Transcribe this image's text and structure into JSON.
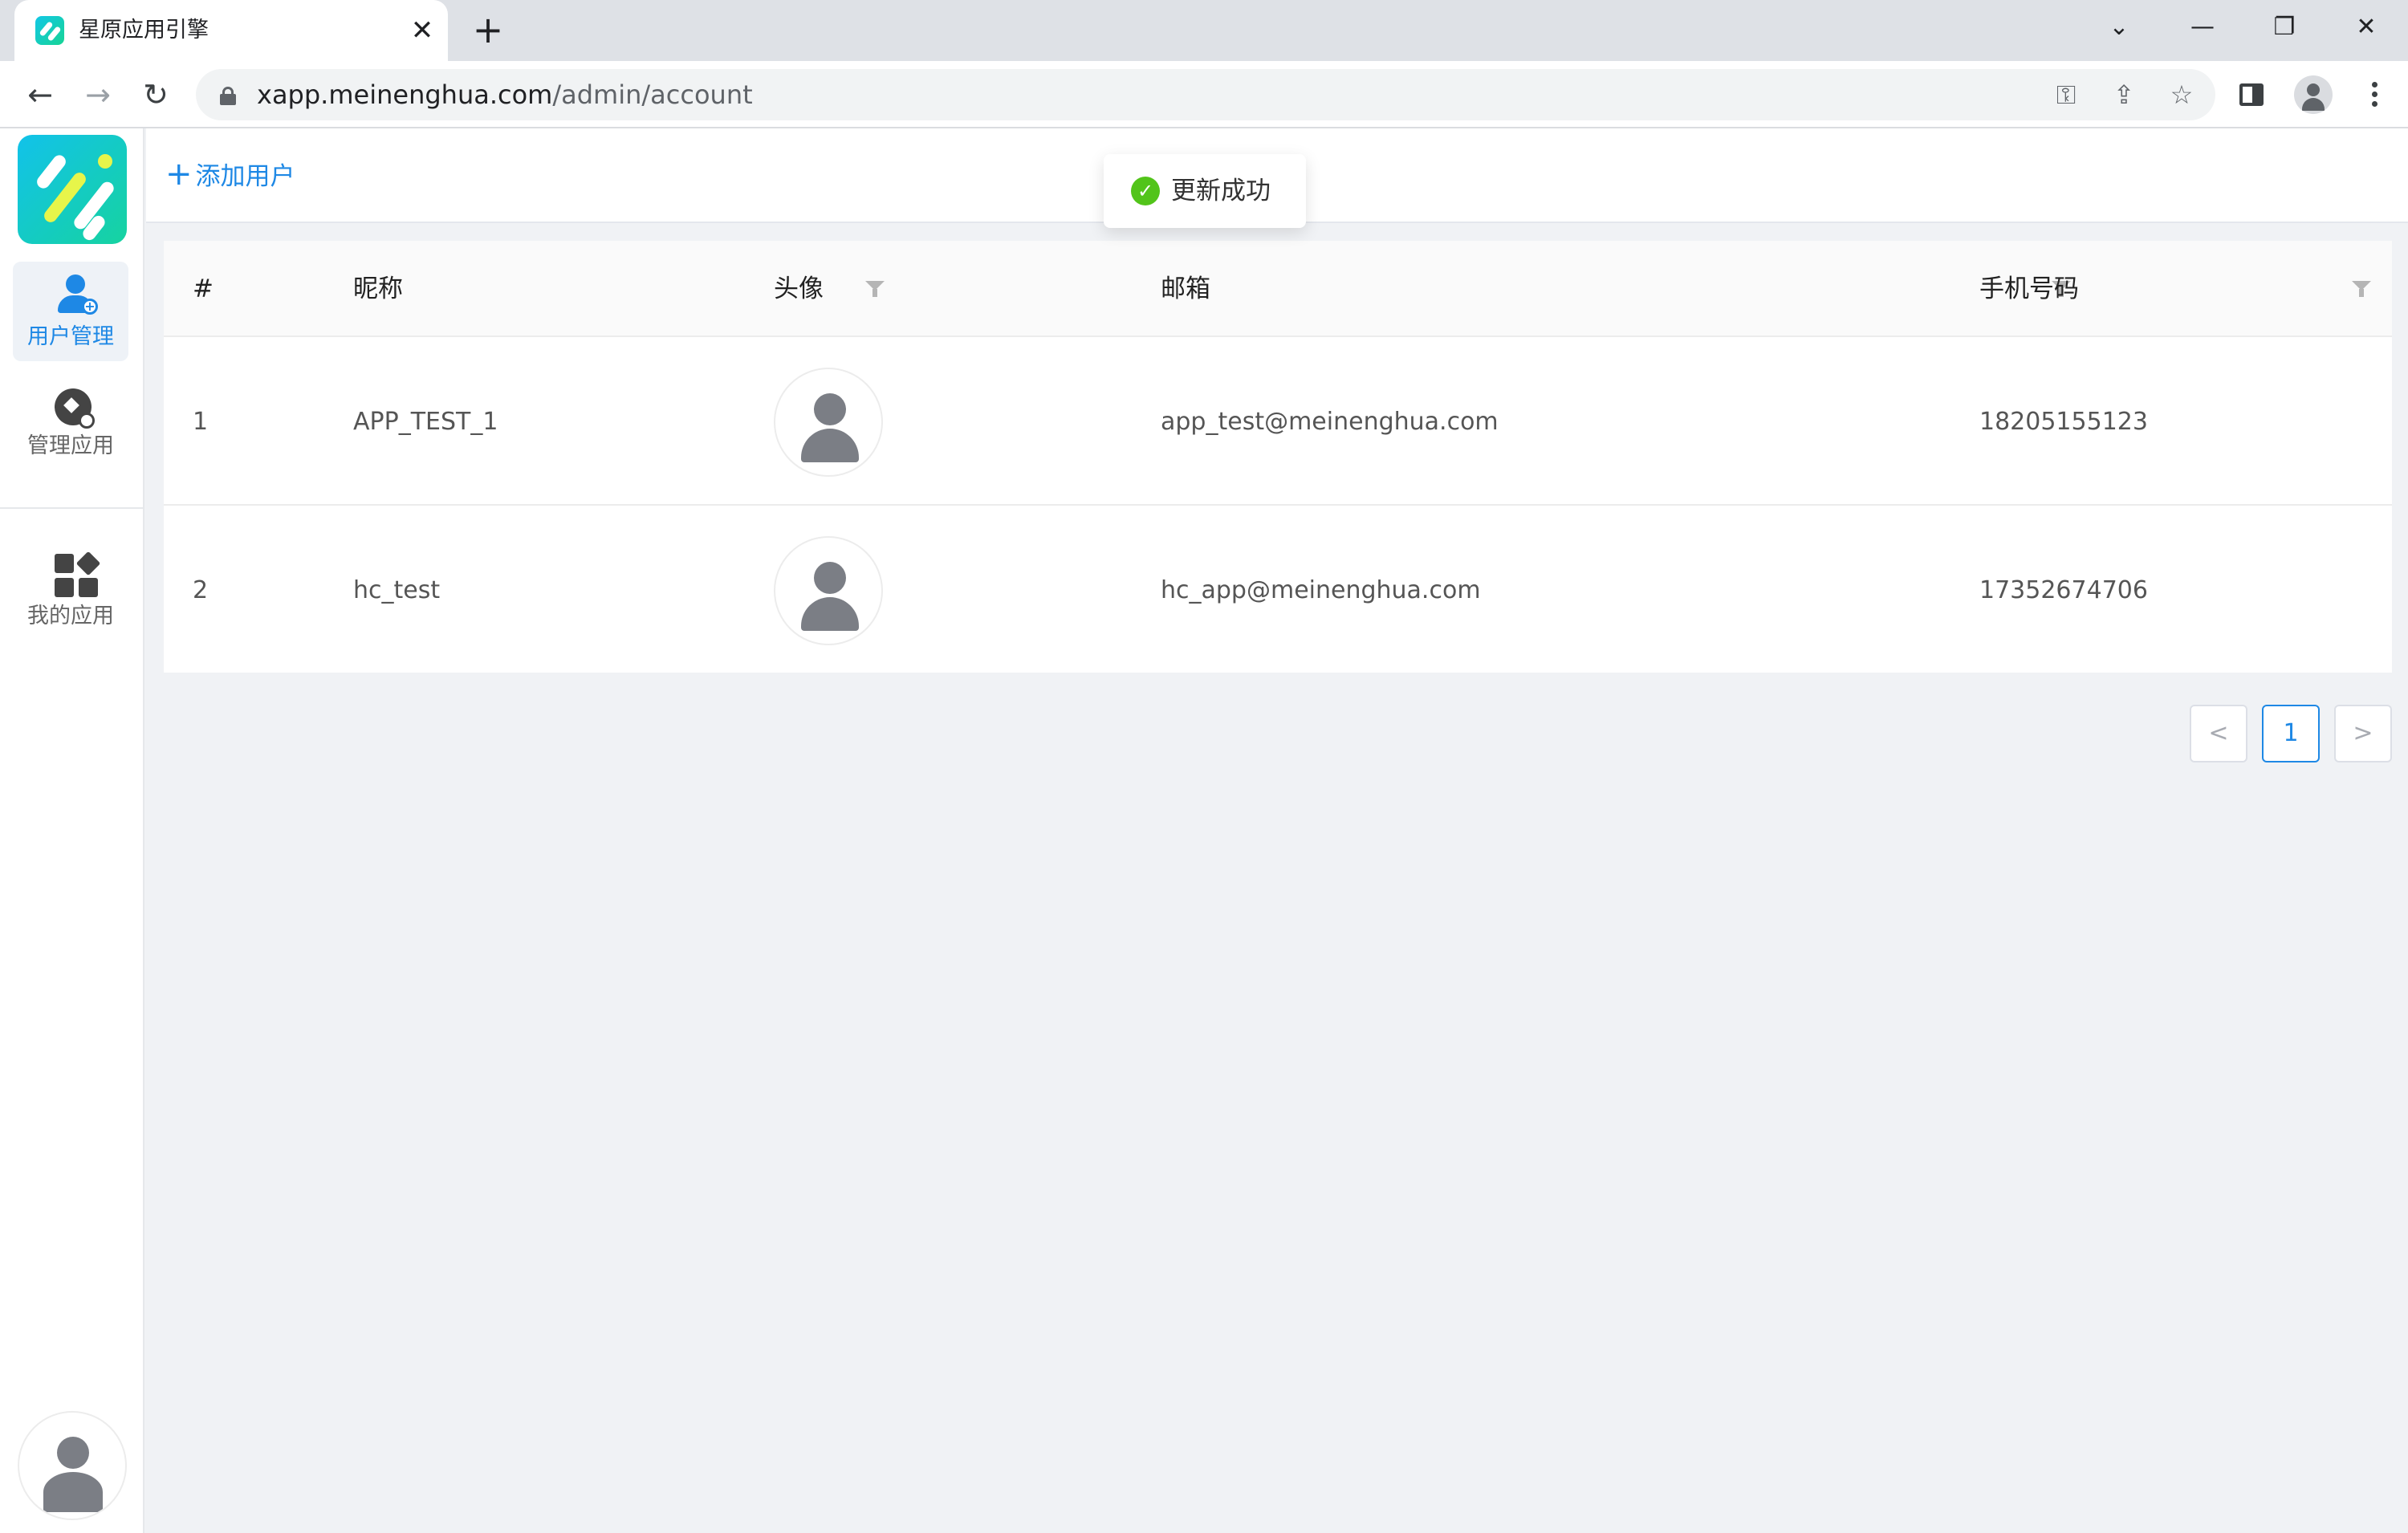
{
  "browser": {
    "tab_title": "星原应用引擎",
    "tab_close": "✕",
    "new_tab": "+",
    "window_controls": {
      "tab_search": "⌄",
      "minimize": "—",
      "restore": "❐",
      "close": "✕"
    },
    "nav": {
      "back": "←",
      "forward": "→",
      "reload": "↻"
    },
    "url_host": "xapp.meinenghua.com",
    "url_path": "/admin/account",
    "omnibox_icons": [
      "key-icon",
      "share-icon",
      "star-icon"
    ]
  },
  "sidebar": {
    "items": [
      {
        "label": "用户管理",
        "icon": "user-add-icon",
        "active": true
      },
      {
        "label": "管理应用",
        "icon": "manage-app-icon",
        "active": false
      },
      {
        "label": "我的应用",
        "icon": "apps-grid-icon",
        "active": false
      }
    ]
  },
  "toolbar": {
    "add_user_label": "添加用户",
    "add_user_icon": "+"
  },
  "toast": {
    "text": "更新成功",
    "icon": "✓",
    "color": "#52c41a"
  },
  "table": {
    "columns": [
      "#",
      "昵称",
      "头像",
      "邮箱",
      "手机号码"
    ],
    "rows": [
      {
        "index": "1",
        "nickname": "APP_TEST_1",
        "email": "app_test@meinenghua.com",
        "phone": "18205155123"
      },
      {
        "index": "2",
        "nickname": "hc_test",
        "email": "hc_app@meinenghua.com",
        "phone": "17352674706"
      }
    ]
  },
  "pagination": {
    "prev": "<",
    "current": "1",
    "next": ">"
  },
  "colors": {
    "accent": "#1e88e5",
    "background": "#f0f2f5",
    "success": "#52c41a"
  }
}
